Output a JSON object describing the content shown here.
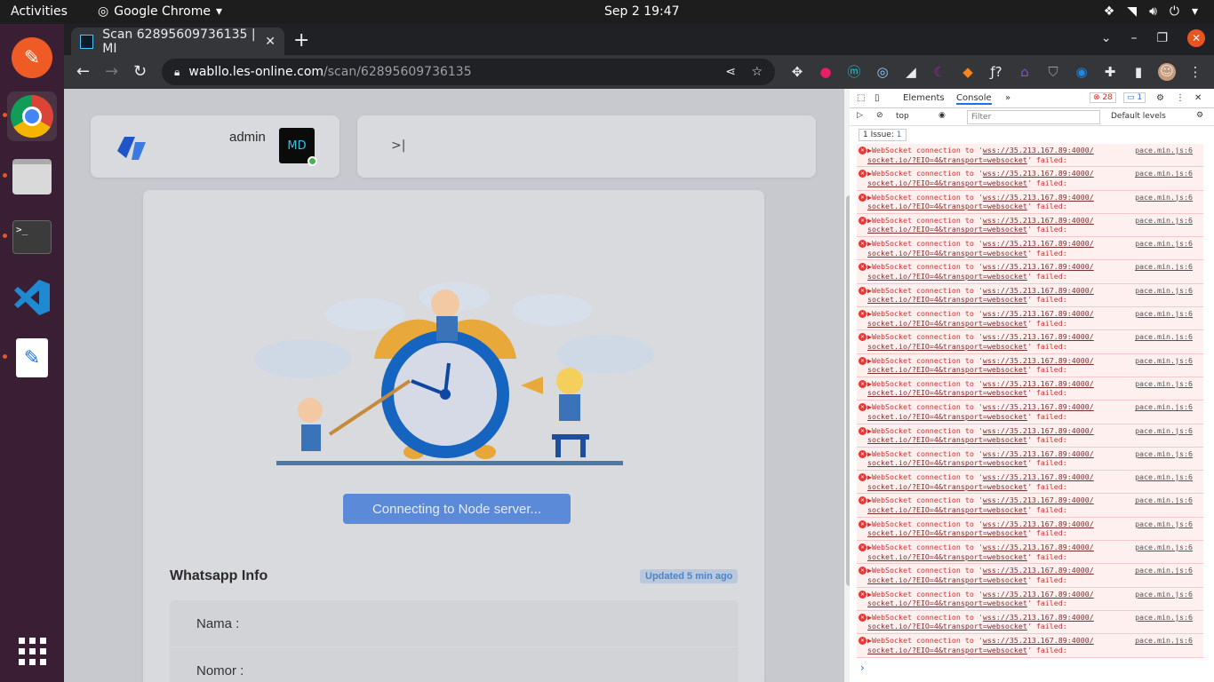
{
  "system": {
    "activities": "Activities",
    "app_name": "Google Chrome",
    "clock": "Sep 2  19:47"
  },
  "browser": {
    "tab_title": "Scan 62895609736135 | MI",
    "url_host": "wabllo.les-online.com",
    "url_path": "/scan/62895609736135"
  },
  "page": {
    "admin_label": "admin",
    "collapse_label": ">|",
    "connect_button": "Connecting to Node server...",
    "wa_title": "Whatsapp Info",
    "wa_badge": "Updated 5 min ago",
    "rows": [
      "Nama :",
      "Nomor :"
    ]
  },
  "devtools": {
    "tabs": [
      "Elements",
      "Console",
      "»"
    ],
    "error_count": "28",
    "info_count": "1",
    "context": "top",
    "filter_placeholder": "Filter",
    "levels": "Default levels",
    "issues": "1 Issue:",
    "issues_count": "1",
    "message_line1": "▶WebSocket connection to '",
    "message_url": "wss://35.213.167.89:4000/",
    "message_line2": "socket.io/?EIO=4&transport=websocket",
    "message_tail": "' failed:",
    "message_source": "pace.min.js:6",
    "message_count": 22
  },
  "colors": {
    "accent": "#5b8ad8",
    "error": "#e53935"
  }
}
